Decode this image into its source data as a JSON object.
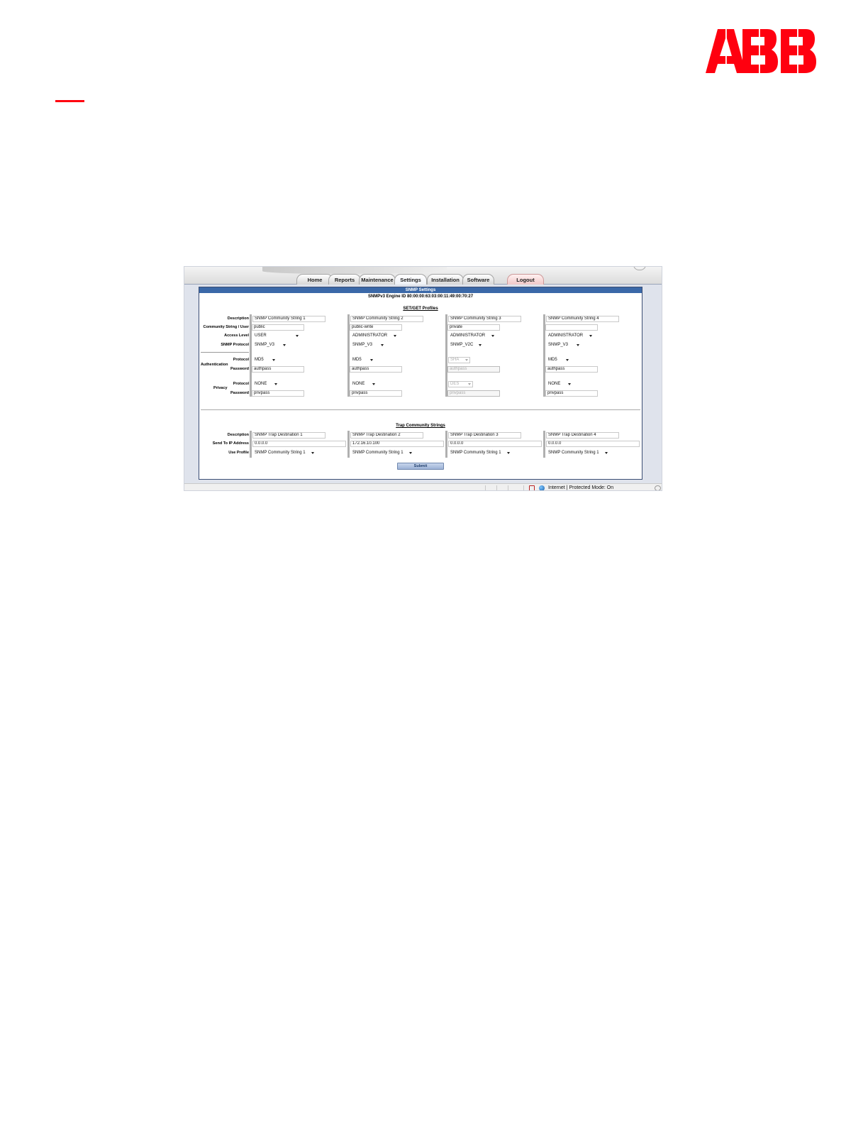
{
  "logo": {
    "name": "ABB",
    "color": "#ff000f"
  },
  "tabs": [
    {
      "label": "Home"
    },
    {
      "label": "Reports"
    },
    {
      "label": "Maintenance"
    },
    {
      "label": "Settings"
    },
    {
      "label": "Installation"
    },
    {
      "label": "Software"
    },
    {
      "label": "Logout"
    }
  ],
  "panel": {
    "title": "SNMP Settings",
    "engine_id": "SNMPv3 Engine ID 80:00:00:63:03:00:11:49:00:70:27"
  },
  "profiles": {
    "title": "SET/GET Profiles",
    "labels": {
      "description": "Description",
      "community": "Community String / User",
      "access_level": "Access Level",
      "snmp_protocol": "SNMP Protocol",
      "authentication": "Authentication",
      "auth_protocol": "Protocol",
      "auth_password": "Password",
      "privacy": "Privacy",
      "priv_protocol": "Protocol",
      "priv_password": "Password"
    },
    "columns": [
      {
        "description": "SNMP Community String 1",
        "community": "public",
        "access_level": "USER",
        "snmp_protocol": "SNMP_V3",
        "auth_protocol": "MD5",
        "auth_password": "authpass",
        "priv_protocol": "NONE",
        "priv_password": "privpass"
      },
      {
        "description": "SNMP Community String 2",
        "community": "public-write",
        "access_level": "ADMINISTRATOR",
        "snmp_protocol": "SNMP_V3",
        "auth_protocol": "MD5",
        "auth_password": "authpass",
        "priv_protocol": "NONE",
        "priv_password": "privpass"
      },
      {
        "description": "SNMP Community String 3",
        "community": "private",
        "access_level": "ADMINISTRATOR",
        "snmp_protocol": "SNMP_V2C",
        "auth_protocol": "SHA",
        "auth_password": "authpass",
        "priv_protocol": "DES",
        "priv_password": "privpass"
      },
      {
        "description": "SNMP Community String 4",
        "community": "",
        "access_level": "ADMINISTRATOR",
        "snmp_protocol": "SNMP_V3",
        "auth_protocol": "MD5",
        "auth_password": "authpass",
        "priv_protocol": "NONE",
        "priv_password": "privpass"
      }
    ]
  },
  "traps": {
    "title": "Trap Community Strings",
    "labels": {
      "description": "Description",
      "send_to": "Send To IP Address",
      "use_profile": "Use Profile"
    },
    "columns": [
      {
        "description": "SNMP Trap Destination 1",
        "ip": "0.0.0.0",
        "profile": "SNMP Community String 1"
      },
      {
        "description": "SNMP Trap Destination 2",
        "ip": "172.16.10.100",
        "profile": "SNMP Community String 1"
      },
      {
        "description": "SNMP Trap Destination 3",
        "ip": "0.0.0.0",
        "profile": "SNMP Community String 1"
      },
      {
        "description": "SNMP Trap Destination 4",
        "ip": "0.0.0.0",
        "profile": "SNMP Community String 1"
      }
    ]
  },
  "submit_label": "Submit",
  "status": {
    "zone_text": "Internet | Protected Mode: On"
  }
}
